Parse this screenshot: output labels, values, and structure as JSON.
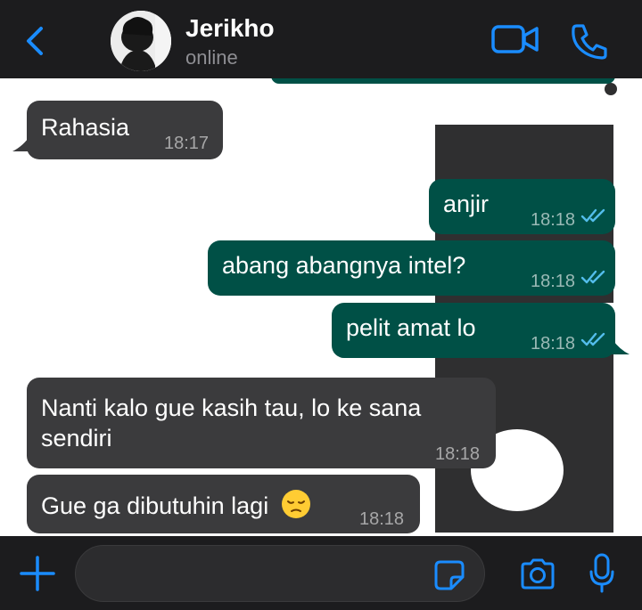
{
  "colors": {
    "accent": "#1a8cff",
    "header_bg": "#1c1c1e",
    "incoming_bubble": "#3b3b3d",
    "outgoing_bubble": "#005046",
    "read_ticks": "#53bdeb"
  },
  "header": {
    "contact_name": "Jerikho",
    "status": "online",
    "icons": [
      "chevron-left-icon",
      "avatar",
      "video-camera-icon",
      "phone-icon"
    ]
  },
  "messages": [
    {
      "direction": "in",
      "text": "Rahasia",
      "time": "18:17"
    },
    {
      "direction": "out",
      "text": "anjir",
      "time": "18:18",
      "status": "read"
    },
    {
      "direction": "out",
      "text": "abang abangnya intel?",
      "time": "18:18",
      "status": "read"
    },
    {
      "direction": "out",
      "text": "pelit amat lo",
      "time": "18:18",
      "status": "read"
    },
    {
      "direction": "in",
      "lines": [
        "Nanti kalo gue kasih tau, lo ke sana",
        "sendiri"
      ],
      "time": "18:18"
    },
    {
      "direction": "in",
      "text": "Gue ga dibutuhin lagi",
      "emoji": "😔",
      "time": "18:18"
    }
  ],
  "input": {
    "value": "",
    "icons": [
      "plus-icon",
      "sticker-icon",
      "camera-icon",
      "microphone-icon"
    ]
  }
}
